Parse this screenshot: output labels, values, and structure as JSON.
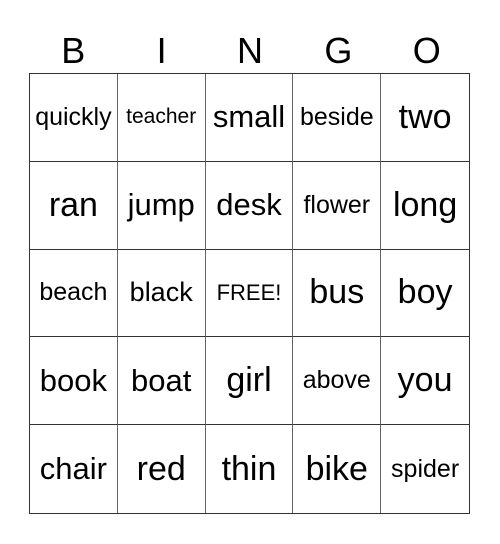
{
  "header": [
    "B",
    "I",
    "N",
    "G",
    "O"
  ],
  "rows": [
    [
      "quickly",
      "teacher",
      "small",
      "beside",
      "two"
    ],
    [
      "ran",
      "jump",
      "desk",
      "flower",
      "long"
    ],
    [
      "beach",
      "black",
      "FREE!",
      "bus",
      "boy"
    ],
    [
      "book",
      "boat",
      "girl",
      "above",
      "you"
    ],
    [
      "chair",
      "red",
      "thin",
      "bike",
      "spider"
    ]
  ]
}
